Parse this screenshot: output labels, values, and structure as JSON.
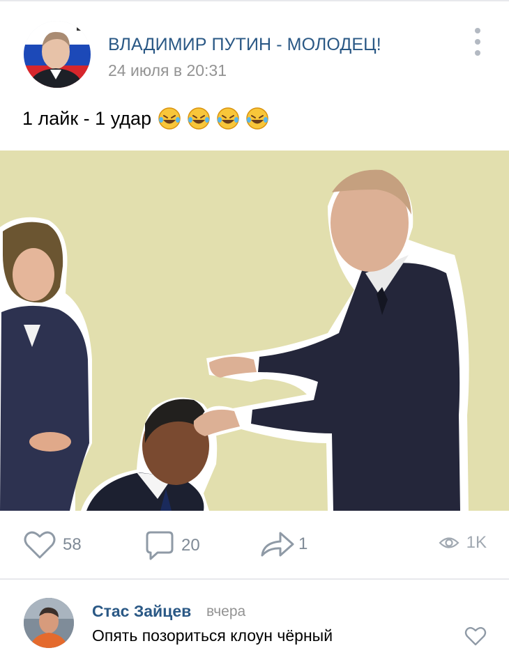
{
  "post": {
    "group_name": "ВЛАДИМИР ПУТИН - МОЛОДЕЦ!",
    "time": "24 июля в 20:31",
    "text": "1 лайк - 1 удар",
    "emoji_count": 4,
    "emoji_name": "rolling-on-the-floor-laughing"
  },
  "image": {
    "description_icon": "caricature-illustration",
    "background_color": "#e2dfae"
  },
  "actions": {
    "likes": "58",
    "comments": "20",
    "shares": "1",
    "views": "1K"
  },
  "comment": {
    "author": "Стас Зайцев",
    "when": "вчера",
    "text": "Опять позориться клоун чёрный"
  },
  "colors": {
    "link": "#2a5885",
    "muted": "#939393",
    "icon": "#7f8a96"
  }
}
